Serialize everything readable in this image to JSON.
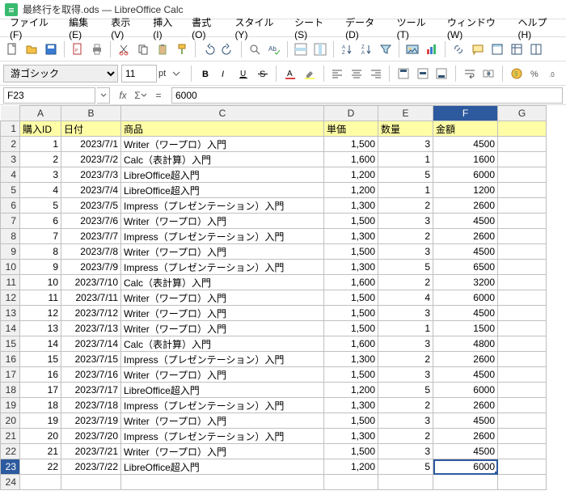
{
  "window": {
    "title": "最終行を取得.ods — LibreOffice Calc"
  },
  "menu": [
    "ファイル(F)",
    "編集(E)",
    "表示(V)",
    "挿入(I)",
    "書式(O)",
    "スタイル(Y)",
    "シート(S)",
    "データ(D)",
    "ツール(T)",
    "ウィンドウ(W)",
    "ヘルプ(H)"
  ],
  "format": {
    "font_name": "游ゴシック",
    "font_size": "11",
    "font_unit": "pt"
  },
  "formula": {
    "cell_ref": "F23",
    "value": "6000",
    "fx_label": "fx",
    "sigma": "Σ",
    "eq": "="
  },
  "columns": [
    "A",
    "B",
    "C",
    "D",
    "E",
    "F",
    "G"
  ],
  "selected_col": "F",
  "selected_row": 23,
  "header_row": {
    "A": "購入ID",
    "B": "日付",
    "C": "商品",
    "D": "単価",
    "E": "数量",
    "F": "金額"
  },
  "rows": [
    {
      "n": 1,
      "A": "1",
      "B": "2023/7/1",
      "C": "Writer（ワープロ）入門",
      "D": "1,500",
      "E": "3",
      "F": "4500"
    },
    {
      "n": 2,
      "A": "2",
      "B": "2023/7/2",
      "C": "Calc（表計算）入門",
      "D": "1,600",
      "E": "1",
      "F": "1600"
    },
    {
      "n": 3,
      "A": "3",
      "B": "2023/7/3",
      "C": "LibreOffice超入門",
      "D": "1,200",
      "E": "5",
      "F": "6000"
    },
    {
      "n": 4,
      "A": "4",
      "B": "2023/7/4",
      "C": "LibreOffice超入門",
      "D": "1,200",
      "E": "1",
      "F": "1200"
    },
    {
      "n": 5,
      "A": "5",
      "B": "2023/7/5",
      "C": "Impress（プレゼンテーション）入門",
      "D": "1,300",
      "E": "2",
      "F": "2600"
    },
    {
      "n": 6,
      "A": "6",
      "B": "2023/7/6",
      "C": "Writer（ワープロ）入門",
      "D": "1,500",
      "E": "3",
      "F": "4500"
    },
    {
      "n": 7,
      "A": "7",
      "B": "2023/7/7",
      "C": "Impress（プレゼンテーション）入門",
      "D": "1,300",
      "E": "2",
      "F": "2600"
    },
    {
      "n": 8,
      "A": "8",
      "B": "2023/7/8",
      "C": "Writer（ワープロ）入門",
      "D": "1,500",
      "E": "3",
      "F": "4500"
    },
    {
      "n": 9,
      "A": "9",
      "B": "2023/7/9",
      "C": "Impress（プレゼンテーション）入門",
      "D": "1,300",
      "E": "5",
      "F": "6500"
    },
    {
      "n": 10,
      "A": "10",
      "B": "2023/7/10",
      "C": "Calc（表計算）入門",
      "D": "1,600",
      "E": "2",
      "F": "3200"
    },
    {
      "n": 11,
      "A": "11",
      "B": "2023/7/11",
      "C": "Writer（ワープロ）入門",
      "D": "1,500",
      "E": "4",
      "F": "6000"
    },
    {
      "n": 12,
      "A": "12",
      "B": "2023/7/12",
      "C": "Writer（ワープロ）入門",
      "D": "1,500",
      "E": "3",
      "F": "4500"
    },
    {
      "n": 13,
      "A": "13",
      "B": "2023/7/13",
      "C": "Writer（ワープロ）入門",
      "D": "1,500",
      "E": "1",
      "F": "1500"
    },
    {
      "n": 14,
      "A": "14",
      "B": "2023/7/14",
      "C": "Calc（表計算）入門",
      "D": "1,600",
      "E": "3",
      "F": "4800"
    },
    {
      "n": 15,
      "A": "15",
      "B": "2023/7/15",
      "C": "Impress（プレゼンテーション）入門",
      "D": "1,300",
      "E": "2",
      "F": "2600"
    },
    {
      "n": 16,
      "A": "16",
      "B": "2023/7/16",
      "C": "Writer（ワープロ）入門",
      "D": "1,500",
      "E": "3",
      "F": "4500"
    },
    {
      "n": 17,
      "A": "17",
      "B": "2023/7/17",
      "C": "LibreOffice超入門",
      "D": "1,200",
      "E": "5",
      "F": "6000"
    },
    {
      "n": 18,
      "A": "18",
      "B": "2023/7/18",
      "C": "Impress（プレゼンテーション）入門",
      "D": "1,300",
      "E": "2",
      "F": "2600"
    },
    {
      "n": 19,
      "A": "19",
      "B": "2023/7/19",
      "C": "Writer（ワープロ）入門",
      "D": "1,500",
      "E": "3",
      "F": "4500"
    },
    {
      "n": 20,
      "A": "20",
      "B": "2023/7/20",
      "C": "Impress（プレゼンテーション）入門",
      "D": "1,300",
      "E": "2",
      "F": "2600"
    },
    {
      "n": 21,
      "A": "21",
      "B": "2023/7/21",
      "C": "Writer（ワープロ）入門",
      "D": "1,500",
      "E": "3",
      "F": "4500"
    },
    {
      "n": 22,
      "A": "22",
      "B": "2023/7/22",
      "C": "LibreOffice超入門",
      "D": "1,200",
      "E": "5",
      "F": "6000"
    }
  ],
  "empty_rows": [
    24
  ]
}
